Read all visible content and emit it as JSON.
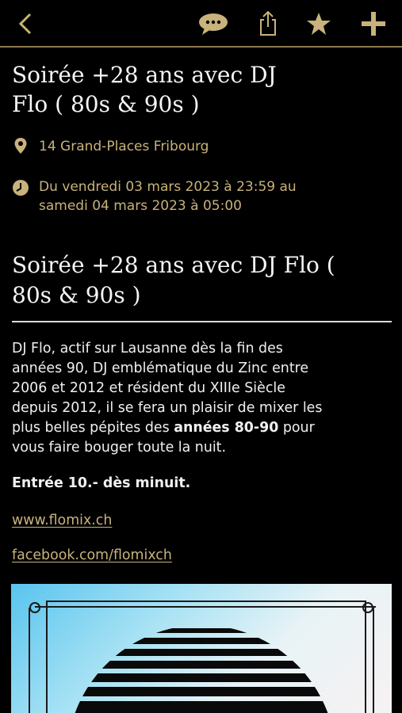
{
  "nav": {
    "back_icon": "chevron-left-icon",
    "chat_icon": "chat-bubble-icon",
    "share_icon": "share-icon",
    "star_icon": "star-icon",
    "add_icon": "plus-icon",
    "accent": "#c9b27b"
  },
  "event": {
    "title_line1": "Soirée +28 ans avec DJ",
    "title_line2": "Flo ( 80s & 90s )",
    "location": "14 Grand-Places Fribourg",
    "date_line1": "Du vendredi 03 mars 2023 à 23:59 au",
    "date_line2": "samedi 04 mars 2023 à 05:00",
    "subtitle_line1": "Soirée +28 ans avec DJ Flo (",
    "subtitle_line2": "80s & 90s )"
  },
  "description": {
    "line1": "DJ Flo, actif sur Lausanne dès la fin des",
    "line2": "années 90, DJ emblématique du Zinc entre",
    "line3": "2006 et 2012 et résident du XIIIe Siècle",
    "line4": "depuis 2012, il se fera un plaisir de mixer les",
    "line5_a": "plus belles pépites des ",
    "line5_bold": "années 80-90",
    "line5_b": " pour",
    "line6": "vous faire bouger toute la nuit.",
    "entry": "Entrée 10.- dès minuit."
  },
  "links": {
    "website": "www.flomix.ch ",
    "facebook": "facebook.com/flomixch"
  }
}
